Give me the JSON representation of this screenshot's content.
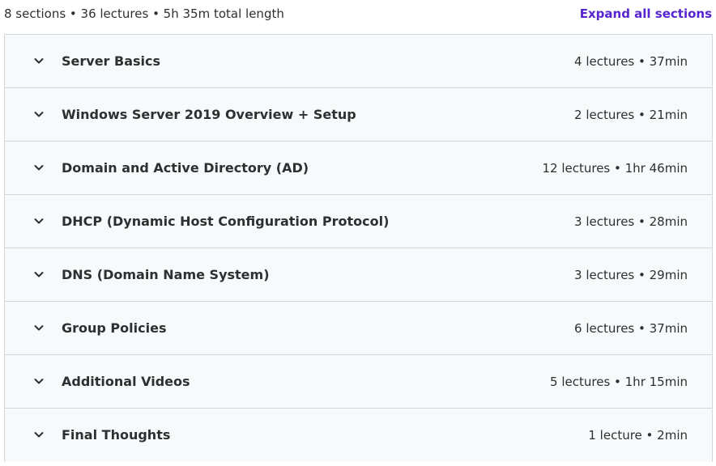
{
  "summary": {
    "text": "8 sections • 36 lectures • 5h 35m total length",
    "expand_all_label": "Expand all sections"
  },
  "icons": {
    "chevron": "chevron-down-icon"
  },
  "colors": {
    "accent": "#5624d0",
    "text": "#2d2f31",
    "row_bg": "#f7f9fa",
    "border": "#d1d7dc"
  },
  "sections": [
    {
      "title": "Server Basics",
      "meta": "4 lectures • 37min"
    },
    {
      "title": "Windows Server 2019 Overview + Setup",
      "meta": "2 lectures • 21min"
    },
    {
      "title": "Domain and Active Directory (AD)",
      "meta": "12 lectures • 1hr 46min"
    },
    {
      "title": "DHCP (Dynamic Host Configuration Protocol)",
      "meta": "3 lectures • 28min"
    },
    {
      "title": "DNS (Domain Name System)",
      "meta": "3 lectures • 29min"
    },
    {
      "title": "Group Policies",
      "meta": "6 lectures • 37min"
    },
    {
      "title": "Additional Videos",
      "meta": "5 lectures • 1hr 15min"
    },
    {
      "title": "Final Thoughts",
      "meta": "1 lecture • 2min"
    }
  ]
}
